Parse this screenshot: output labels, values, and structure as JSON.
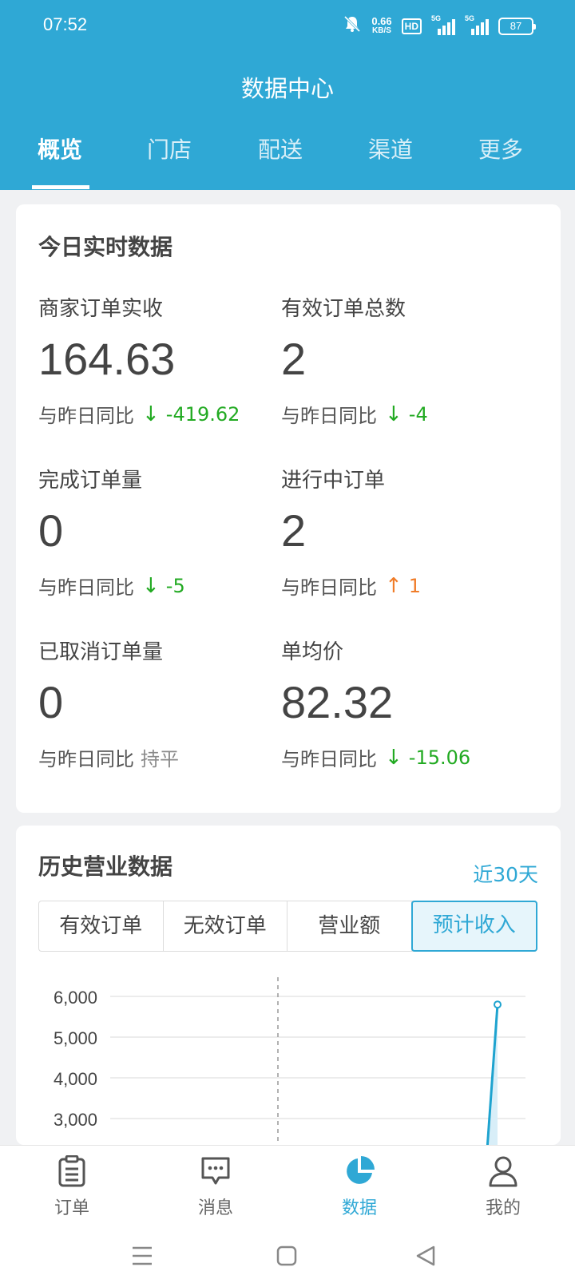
{
  "status": {
    "time": "07:52",
    "net_speed": "0.66",
    "net_unit": "KB/S",
    "hd": "HD",
    "sig1": "5G",
    "sig2": "5G",
    "battery": "87"
  },
  "header": {
    "title": "数据中心",
    "tabs": [
      "概览",
      "门店",
      "配送",
      "渠道",
      "更多"
    ],
    "active_tab": 0
  },
  "realtime": {
    "title": "今日实时数据",
    "metrics": [
      {
        "label": "商家订单实收",
        "value": "164.63",
        "compare_label": "与昨日同比",
        "trend": "down",
        "arrow": "↓",
        "delta": "-419.62"
      },
      {
        "label": "有效订单总数",
        "value": "2",
        "compare_label": "与昨日同比",
        "trend": "down",
        "arrow": "↓",
        "delta": "-4"
      },
      {
        "label": "完成订单量",
        "value": "0",
        "compare_label": "与昨日同比",
        "trend": "down",
        "arrow": "↓",
        "delta": "-5"
      },
      {
        "label": "进行中订单",
        "value": "2",
        "compare_label": "与昨日同比",
        "trend": "up",
        "arrow": "↑",
        "delta": "1"
      },
      {
        "label": "已取消订单量",
        "value": "0",
        "compare_label": "与昨日同比",
        "trend": "flat",
        "arrow": "",
        "delta": "持平"
      },
      {
        "label": "单均价",
        "value": "82.32",
        "compare_label": "与昨日同比",
        "trend": "down",
        "arrow": "↓",
        "delta": "-15.06"
      }
    ]
  },
  "history": {
    "title": "历史营业数据",
    "range_link": "近30天",
    "segments": [
      "有效订单",
      "无效订单",
      "营业额",
      "预计收入"
    ],
    "active_segment": 3
  },
  "chart_data": {
    "type": "line",
    "ytick_labels": [
      "6,000",
      "5,000",
      "4,000",
      "3,000"
    ],
    "yticks": [
      6000,
      5000,
      4000,
      3000
    ],
    "ylim": [
      3000,
      6000
    ],
    "series": [
      {
        "values": [
          5800
        ]
      }
    ],
    "line_color": "#1ea3cf"
  },
  "tabbar": {
    "items": [
      "订单",
      "消息",
      "数据",
      "我的"
    ],
    "active": 2
  },
  "colors": {
    "primary": "#2fa8d5",
    "down": "#22aa22",
    "up": "#f07c28"
  }
}
